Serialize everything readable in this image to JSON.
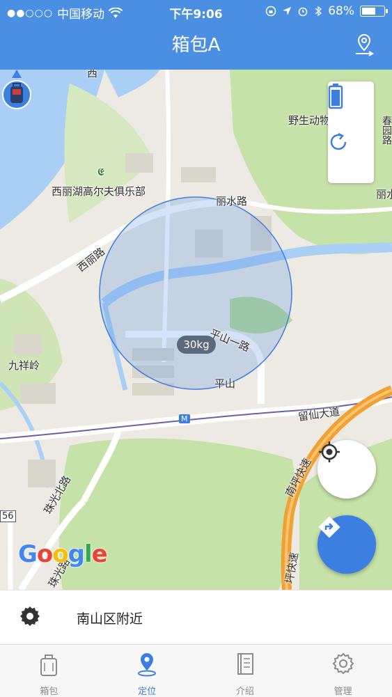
{
  "status_bar": {
    "carrier": "中国移动",
    "time": "下午9:06",
    "battery": "68%",
    "battery_level": 0.68
  },
  "header": {
    "title": "箱包A"
  },
  "map": {
    "labels": {
      "lake_club": "西丽湖高尔夫俱乐部",
      "west_lake": "西",
      "zoo": "野生动物",
      "spring_road": "春园路",
      "lishui_road": "丽水路",
      "li_right": "丽水",
      "xili_road": "西丽路",
      "jiuxiang_ling": "九祥岭",
      "pingshan_1st": "平山一路",
      "pingshan": "平山",
      "liuxian_avenue": "留仙大道",
      "nanping_express": "南坪快速",
      "zhuguang_north": "珠光北路",
      "zhuguang_road": "珠光路",
      "ping_express": "坪快速",
      "road_56": "56",
      "metro": "M"
    },
    "weight_badge": "30kg",
    "google_logo": [
      "G",
      "o",
      "o",
      "g",
      "l",
      "e"
    ],
    "colors": {
      "accent": "#4a8fe2",
      "water": "#a9cff5",
      "park": "#c5e2a8",
      "circle": "#3d7fe0"
    }
  },
  "address": {
    "text": "南山区附近"
  },
  "tabs": [
    {
      "label": "箱包",
      "icon": "bag-icon",
      "active": false
    },
    {
      "label": "定位",
      "icon": "location-pin-icon",
      "active": true
    },
    {
      "label": "介绍",
      "icon": "book-icon",
      "active": false
    },
    {
      "label": "管理",
      "icon": "gear-icon",
      "active": false
    }
  ]
}
